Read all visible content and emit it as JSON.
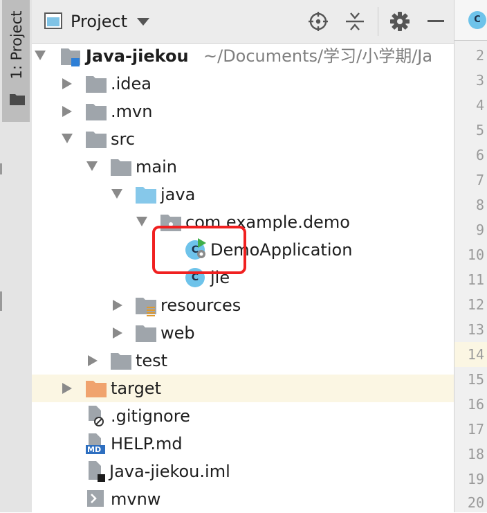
{
  "side_strip": {
    "label": "1: Project"
  },
  "header": {
    "title": "Project"
  },
  "project": {
    "name": "Java-jiekou",
    "path": "~/Documents/学习/小学期/Ja"
  },
  "tree": {
    "idea": ".idea",
    "mvn": ".mvn",
    "src": "src",
    "main": "main",
    "java": "java",
    "package": "com.example.demo",
    "demo_app": "DemoApplication",
    "jie": "jie",
    "resources": "resources",
    "web": "web",
    "test": "test",
    "target": "target",
    "gitignore": ".gitignore",
    "help": "HELP.md",
    "iml": "Java-jiekou.iml",
    "mvnw": "mvnw"
  },
  "file_badges": {
    "md": "MD",
    "class": "C"
  },
  "editor": {
    "tab_icon": "C"
  },
  "line_numbers": [
    "2",
    "3",
    "4",
    "5",
    "6",
    "7",
    "8",
    "9",
    "10",
    "11",
    "12",
    "13",
    "14",
    "15",
    "16",
    "17",
    "18",
    "19",
    "20"
  ],
  "colors": {
    "folder_gray": "#9fa5ab",
    "source_folder": "#86c8ea",
    "target_folder": "#f0a36e",
    "class_icon": "#6ec3ea",
    "highlight": "#f02020"
  }
}
